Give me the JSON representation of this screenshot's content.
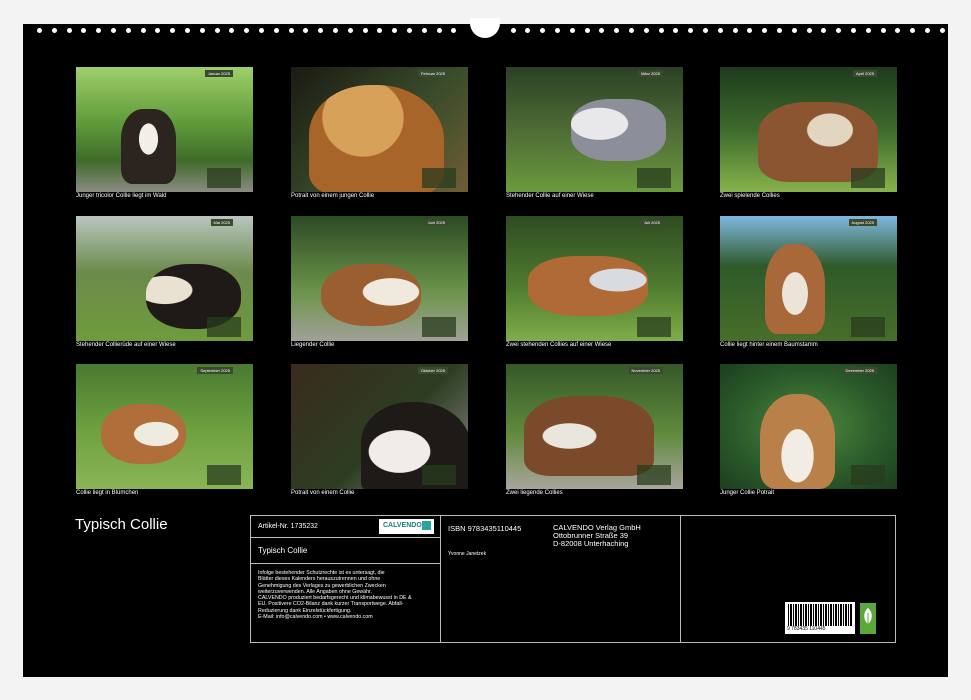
{
  "tiles": [
    {
      "caption": "Junger tricolor Collie liegt im Wald",
      "month": "Januar 2025"
    },
    {
      "caption": "Potrait von einem jungen Collie",
      "month": "Februar 2025"
    },
    {
      "caption": "Stehender Collie auf einer Wiese",
      "month": "März 2025"
    },
    {
      "caption": "Zwei spielende Collies",
      "month": "April 2025"
    },
    {
      "caption": "Stehender Collierüde auf einer Wiese",
      "month": "Mai 2025"
    },
    {
      "caption": "Liegender Collie",
      "month": "Juni 2025"
    },
    {
      "caption": "Zwei stehenden Collies auf einer Wiese",
      "month": "Juli 2025"
    },
    {
      "caption": "Collie liegt hinter einem Baumstamm",
      "month": "August 2025"
    },
    {
      "caption": "Collie liegt in Blümchen",
      "month": "September 2025"
    },
    {
      "caption": "Potrait von einem Collie",
      "month": "Oktober 2025"
    },
    {
      "caption": "Zwei liegende Collies",
      "month": "November 2025"
    },
    {
      "caption": "Junger Collie Potrait",
      "month": "Dezember 2025"
    }
  ],
  "cover_title": "Typisch Collie",
  "info": {
    "article": "Artikel-Nr. 1735232",
    "logo": "CALVENDO",
    "calendar_title": "Typisch Collie",
    "legal": [
      "Infolge bestehender Schutzrechte ist es untersagt, die",
      "Blätter dieses Kalenders herauszutrennen und ohne",
      "Genehmigung des Verlages zu gewerblichen Zwecken",
      "weiterzuverwenden. Alle Angaben ohne Gewähr.",
      "CALVENDO produziert bedarfsgerecht und klimabewusst in DE &",
      "EU. Positivere CO2-Bilanz dank kurzer Transportwege. Abfall-",
      "Reduzierung dank Einzelstückfertigung.",
      "E-Mail: info@calvendo.com • www.calvendo.com"
    ],
    "isbn": "ISBN 9783435110445",
    "author": "Yvonne Janetzek",
    "publisher": [
      "CALVENDO Verlag GmbH",
      "Ottobrunner Straße 39",
      "D-82008 Unterhaching"
    ],
    "barcode_digits": "9 783435 110445"
  }
}
